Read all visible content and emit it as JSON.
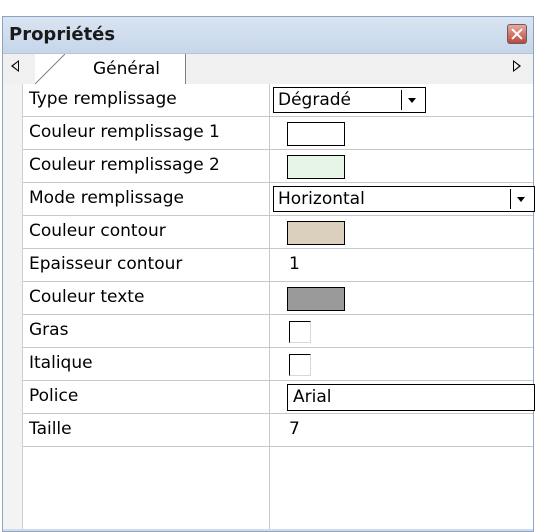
{
  "panel": {
    "title": "Propriétés",
    "tab_label": "Général"
  },
  "colors": {
    "fill_color_1": "#ffffff",
    "fill_color_2": "#e6f5e6",
    "outline_color": "#dbcfbd",
    "text_color": "#9a9a9a"
  },
  "rows": [
    {
      "label": "Type remplissage",
      "value": "Dégradé"
    },
    {
      "label": "Couleur remplissage 1"
    },
    {
      "label": "Couleur remplissage 2"
    },
    {
      "label": "Mode remplissage",
      "value": "Horizontal"
    },
    {
      "label": "Couleur contour"
    },
    {
      "label": "Epaisseur contour",
      "value": "1"
    },
    {
      "label": "Couleur texte"
    },
    {
      "label": "Gras"
    },
    {
      "label": "Italique"
    },
    {
      "label": "Police",
      "value": "Arial"
    },
    {
      "label": "Taille",
      "value": "7"
    }
  ]
}
